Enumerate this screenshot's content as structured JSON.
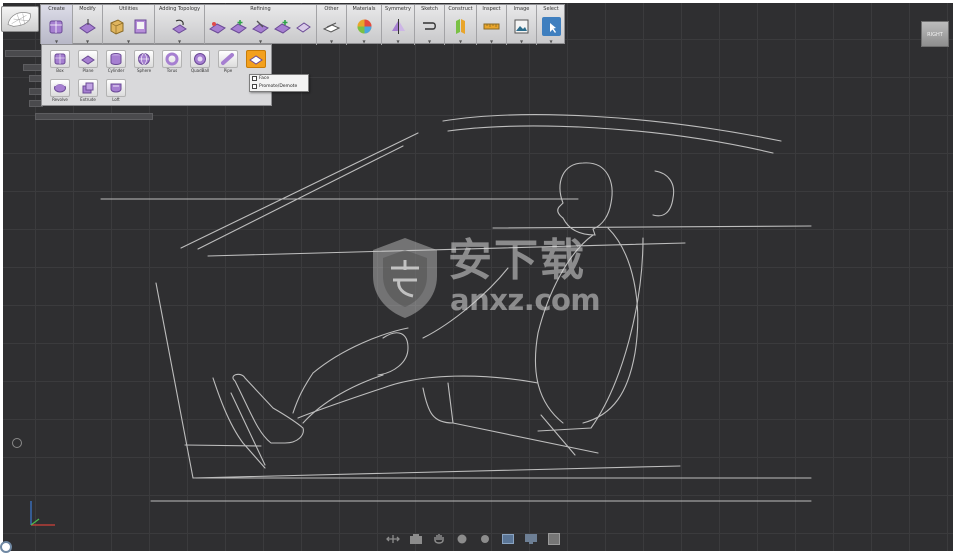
{
  "toolbar": {
    "groups": [
      {
        "label": "Create",
        "icons": [
          "primitive-box-icon"
        ]
      },
      {
        "label": "Modify",
        "icons": [
          "modify-icon"
        ]
      },
      {
        "label": "Utilities",
        "icons": [
          "utility-cube-icon",
          "utility-panel-icon"
        ]
      },
      {
        "label": "Adding Topology",
        "icons": [
          "add-topology-icon"
        ]
      },
      {
        "label": "Refining",
        "icons": [
          "refine-1-icon",
          "refine-2-icon",
          "refine-3-icon",
          "refine-4-icon",
          "refine-5-icon"
        ]
      },
      {
        "label": "Other",
        "icons": [
          "other-icon"
        ]
      },
      {
        "label": "Materials",
        "icons": [
          "materials-icon"
        ]
      },
      {
        "label": "Symmetry",
        "icons": [
          "symmetry-icon"
        ]
      },
      {
        "label": "Sketch",
        "icons": [
          "sketch-icon"
        ]
      },
      {
        "label": "Construct",
        "icons": [
          "construct-icon"
        ]
      },
      {
        "label": "Inspect",
        "icons": [
          "inspect-icon"
        ]
      },
      {
        "label": "Image",
        "icons": [
          "image-icon"
        ]
      },
      {
        "label": "Select",
        "icons": [
          "select-icon"
        ]
      }
    ]
  },
  "create_panel": {
    "row1": [
      {
        "label": "Box",
        "icon": "box-icon"
      },
      {
        "label": "Plane",
        "icon": "plane-icon"
      },
      {
        "label": "Cylinder",
        "icon": "cylinder-icon"
      },
      {
        "label": "Sphere",
        "icon": "sphere-icon"
      },
      {
        "label": "Torus",
        "icon": "torus-icon"
      },
      {
        "label": "QuadBall",
        "icon": "quadball-icon"
      },
      {
        "label": "Pipe",
        "icon": "pipe-icon"
      },
      {
        "label": "",
        "icon": "plane-highlight-icon"
      }
    ],
    "row2": [
      {
        "label": "Revolve",
        "icon": "revolve-icon"
      },
      {
        "label": "Extrude",
        "icon": "extrude-icon"
      },
      {
        "label": "Loft",
        "icon": "loft-icon"
      }
    ]
  },
  "plane_menu": {
    "items": [
      "Face",
      "Promote/Demote"
    ]
  },
  "view_label": "RIGHT",
  "watermark": {
    "title": "安下载",
    "url": "anxz.com"
  },
  "colors": {
    "viewport_bg": "#2f2f31",
    "grid_line": "#3b3b3d",
    "sketch_line": "#bdbdbd",
    "accent_purple": "#8d63b8",
    "accent_orange": "#f3a01d",
    "select_blue": "#3f7fbf"
  }
}
